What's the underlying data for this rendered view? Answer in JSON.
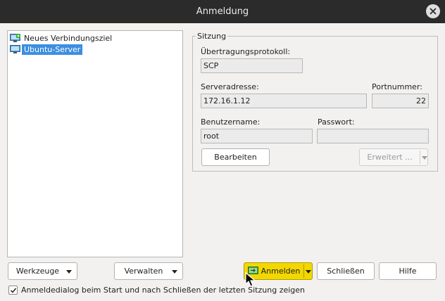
{
  "window": {
    "title": "Anmeldung"
  },
  "sites": [
    {
      "label": "Neues Verbindungsziel",
      "selected": false
    },
    {
      "label": "Ubuntu-Server",
      "selected": true
    }
  ],
  "session": {
    "group_label": "Sitzung",
    "protocol": {
      "label": "Übertragungsprotokoll:",
      "value": "SCP"
    },
    "host": {
      "label": "Serveradresse:",
      "value": "172.16.1.12"
    },
    "port": {
      "label": "Portnummer:",
      "value": "22"
    },
    "user": {
      "label": "Benutzername:",
      "value": "root"
    },
    "password": {
      "label": "Passwort:",
      "value": ""
    },
    "edit_label": "Bearbeiten",
    "advanced_label": "Erweitert ..."
  },
  "footer": {
    "tools_label": "Werkzeuge",
    "manage_label": "Verwalten",
    "login_label": "Anmelden",
    "close_label": "Schließen",
    "help_label": "Hilfe",
    "show_dialog_label": "Anmeldedialog beim Start und nach Schließen der letzten Sitzung zeigen",
    "show_dialog_checked": true
  },
  "colors": {
    "accent": "#f2d800",
    "selection": "#3d8ee0",
    "titlebar": "#2b2b2b"
  }
}
